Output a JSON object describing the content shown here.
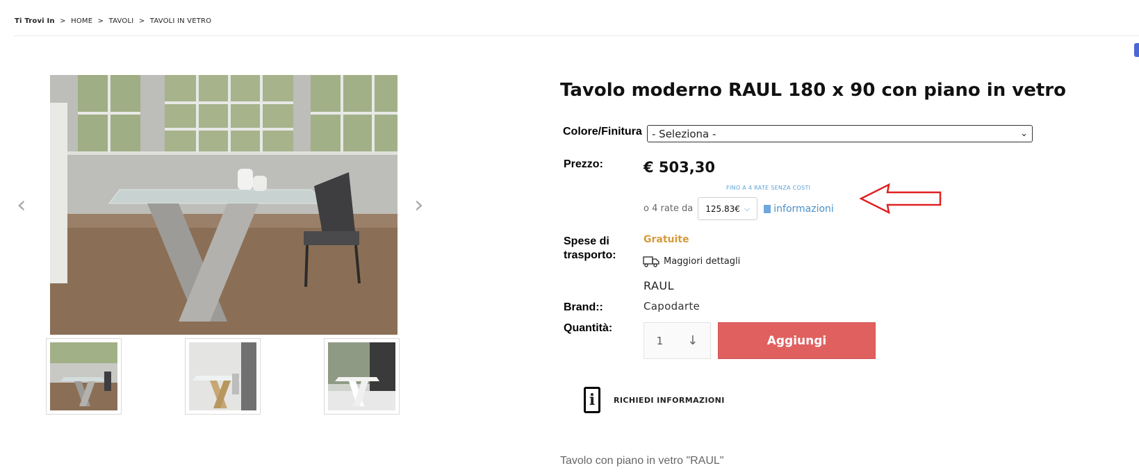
{
  "breadcrumb": {
    "lead": "Ti Trovi In",
    "items": [
      "HOME",
      "TAVOLI",
      "TAVOLI IN VETRO"
    ],
    "separator": ">"
  },
  "gallery": {
    "prev": "‹",
    "next": "›"
  },
  "product": {
    "title": "Tavolo moderno RAUL 180 x 90 con piano in vetro",
    "color_label": "Colore/Finitura",
    "color_select": "- Seleziona -",
    "price_label": "Prezzo:",
    "price": "€ 503,30",
    "installment_note": "FINO A 4 RATE SENZA COSTI",
    "installment_prefix": "o 4 rate da",
    "installment_value": "125.83€",
    "info_link": "informazioni",
    "shipping_label_1": "Spese di",
    "shipping_label_2": "trasporto:",
    "shipping_value": "Gratuite",
    "shipping_details": "Maggiori dettagli",
    "model": "RAUL",
    "brand_label": "Brand::",
    "brand_value": "Capodarte",
    "qty_label": "Quantità:",
    "qty_value": "1",
    "add_button": "Aggiungi",
    "request_info": "RICHIEDI INFORMAZIONI",
    "description": "Tavolo con piano in vetro \"RAUL\""
  },
  "colors": {
    "add_button_bg": "#e06060",
    "shipping_free": "#d69a3a",
    "link": "#4a90c8",
    "annotation_arrow": "#e02020"
  }
}
